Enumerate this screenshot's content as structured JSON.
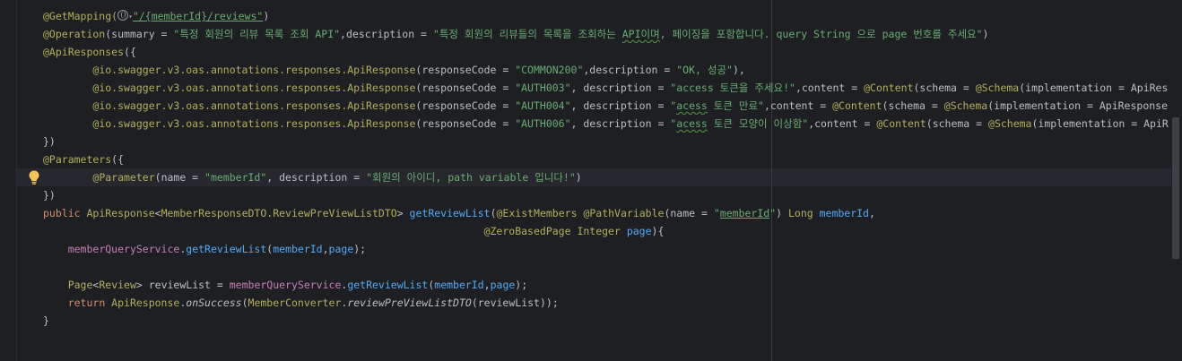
{
  "editor": {
    "lines": [
      {
        "segments": [
          {
            "t": "@GetMapping(",
            "c": "ann"
          },
          {
            "t": "icon:globe"
          },
          {
            "t": "\"/{memberId}/reviews\"",
            "c": "str u"
          },
          {
            "t": ")",
            "c": "dim"
          }
        ]
      },
      {
        "segments": [
          {
            "t": "@Operation",
            "c": "ann"
          },
          {
            "t": "(summary = ",
            "c": "dim"
          },
          {
            "t": "\"특정 회원의 리뷰 목록 조회 API\"",
            "c": "str"
          },
          {
            "t": ",description = ",
            "c": "dim"
          },
          {
            "t": "\"특정 회원의 리뷰들의 목록을 조회하는 ",
            "c": "str"
          },
          {
            "t": "API이며",
            "c": "str squig"
          },
          {
            "t": ", 페이징을 포함합니다. query String 으로 page 번호를 주세요\"",
            "c": "str"
          },
          {
            "t": ")",
            "c": "dim"
          }
        ]
      },
      {
        "segments": [
          {
            "t": "@ApiResponses",
            "c": "ann"
          },
          {
            "t": "({",
            "c": "dim"
          }
        ]
      },
      {
        "segments": [
          {
            "t": "        "
          },
          {
            "t": "@io.swagger.v3.oas.annotations.responses.ApiResponse",
            "c": "ann"
          },
          {
            "t": "(responseCode = ",
            "c": "dim"
          },
          {
            "t": "\"COMMON200\"",
            "c": "str"
          },
          {
            "t": ",description = ",
            "c": "dim"
          },
          {
            "t": "\"OK, 성공\"",
            "c": "str"
          },
          {
            "t": "),",
            "c": "dim"
          }
        ]
      },
      {
        "segments": [
          {
            "t": "        "
          },
          {
            "t": "@io.swagger.v3.oas.annotations.responses.ApiResponse",
            "c": "ann"
          },
          {
            "t": "(responseCode = ",
            "c": "dim"
          },
          {
            "t": "\"AUTH003\"",
            "c": "str"
          },
          {
            "t": ", description = ",
            "c": "dim"
          },
          {
            "t": "\"access 토큰을 주세요!\"",
            "c": "str"
          },
          {
            "t": ",content = ",
            "c": "dim"
          },
          {
            "t": "@Content",
            "c": "ann"
          },
          {
            "t": "(schema = ",
            "c": "dim"
          },
          {
            "t": "@Schema",
            "c": "ann"
          },
          {
            "t": "(implementation = ApiRes",
            "c": "dim"
          }
        ]
      },
      {
        "segments": [
          {
            "t": "        "
          },
          {
            "t": "@io.swagger.v3.oas.annotations.responses.ApiResponse",
            "c": "ann"
          },
          {
            "t": "(responseCode = ",
            "c": "dim"
          },
          {
            "t": "\"AUTH004\"",
            "c": "str"
          },
          {
            "t": ", description = ",
            "c": "dim"
          },
          {
            "t": "\"",
            "c": "str"
          },
          {
            "t": "acess",
            "c": "str squig"
          },
          {
            "t": " 토큰 만료\"",
            "c": "str"
          },
          {
            "t": ",content = ",
            "c": "dim"
          },
          {
            "t": "@Content",
            "c": "ann"
          },
          {
            "t": "(schema = ",
            "c": "dim"
          },
          {
            "t": "@Schema",
            "c": "ann"
          },
          {
            "t": "(implementation = ApiResponse",
            "c": "dim"
          }
        ]
      },
      {
        "segments": [
          {
            "t": "        "
          },
          {
            "t": "@io.swagger.v3.oas.annotations.responses.ApiResponse",
            "c": "ann"
          },
          {
            "t": "(responseCode = ",
            "c": "dim"
          },
          {
            "t": "\"AUTH006\"",
            "c": "str"
          },
          {
            "t": ", description = ",
            "c": "dim"
          },
          {
            "t": "\"",
            "c": "str"
          },
          {
            "t": "acess",
            "c": "str squig"
          },
          {
            "t": " 토큰 모양이 이상함\"",
            "c": "str"
          },
          {
            "t": ",content = ",
            "c": "dim"
          },
          {
            "t": "@Content",
            "c": "ann"
          },
          {
            "t": "(schema = ",
            "c": "dim"
          },
          {
            "t": "@Schema",
            "c": "ann"
          },
          {
            "t": "(implementation = ApiR",
            "c": "dim"
          }
        ]
      },
      {
        "segments": [
          {
            "t": "})",
            "c": "dim"
          }
        ]
      },
      {
        "segments": [
          {
            "t": "@Parameters",
            "c": "ann"
          },
          {
            "t": "({",
            "c": "dim"
          }
        ]
      },
      {
        "segments": [
          {
            "t": "        "
          },
          {
            "t": "@Parameter",
            "c": "ann"
          },
          {
            "t": "(name = ",
            "c": "dim"
          },
          {
            "t": "\"memberId\"",
            "c": "str"
          },
          {
            "t": ", description = ",
            "c": "dim"
          },
          {
            "t": "\"회원의 아이디, path variable 입니다!\"",
            "c": "str"
          },
          {
            "t": ")",
            "c": "dim"
          }
        ]
      },
      {
        "segments": [
          {
            "t": "})",
            "c": "dim"
          }
        ]
      },
      {
        "segments": [
          {
            "t": "public ",
            "c": "kw"
          },
          {
            "t": "ApiResponse",
            "c": "ann"
          },
          {
            "t": "<",
            "c": "dim"
          },
          {
            "t": "MemberResponseDTO.ReviewPreViewListDTO",
            "c": "ann"
          },
          {
            "t": "> ",
            "c": "dim"
          },
          {
            "t": "getReviewList",
            "c": "method"
          },
          {
            "t": "(",
            "c": "dim"
          },
          {
            "t": "@ExistMembers ",
            "c": "ann"
          },
          {
            "t": "@PathVariable",
            "c": "ann"
          },
          {
            "t": "(name = ",
            "c": "dim"
          },
          {
            "t": "\"",
            "c": "str"
          },
          {
            "t": "memberId",
            "c": "str u"
          },
          {
            "t": "\"",
            "c": "str"
          },
          {
            "t": ") ",
            "c": "dim"
          },
          {
            "t": "Long ",
            "c": "ann"
          },
          {
            "t": "memberId",
            "c": "method"
          },
          {
            "t": ",",
            "c": "dim"
          }
        ]
      },
      {
        "segments": [
          {
            "t": "                                                                       "
          },
          {
            "t": "@ZeroBasedPage ",
            "c": "ann"
          },
          {
            "t": "Integer ",
            "c": "ann"
          },
          {
            "t": "page",
            "c": "method"
          },
          {
            "t": "){",
            "c": "dim"
          }
        ]
      },
      {
        "segments": [
          {
            "t": "    "
          },
          {
            "t": "memberQueryService",
            "c": "field"
          },
          {
            "t": ".",
            "c": "dim"
          },
          {
            "t": "getReviewList",
            "c": "method"
          },
          {
            "t": "(",
            "c": "dim"
          },
          {
            "t": "memberId",
            "c": "method"
          },
          {
            "t": ",",
            "c": "dim"
          },
          {
            "t": "page",
            "c": "method"
          },
          {
            "t": ");",
            "c": "dim"
          }
        ]
      },
      {
        "segments": [
          {
            "t": ""
          }
        ]
      },
      {
        "segments": [
          {
            "t": "    "
          },
          {
            "t": "Page",
            "c": "ann"
          },
          {
            "t": "<",
            "c": "dim"
          },
          {
            "t": "Review",
            "c": "ann"
          },
          {
            "t": "> reviewList = ",
            "c": "dim"
          },
          {
            "t": "memberQueryService",
            "c": "field"
          },
          {
            "t": ".",
            "c": "dim"
          },
          {
            "t": "getReviewList",
            "c": "method"
          },
          {
            "t": "(",
            "c": "dim"
          },
          {
            "t": "memberId",
            "c": "method"
          },
          {
            "t": ",",
            "c": "dim"
          },
          {
            "t": "page",
            "c": "method"
          },
          {
            "t": ");",
            "c": "dim"
          }
        ]
      },
      {
        "segments": [
          {
            "t": "    "
          },
          {
            "t": "return ",
            "c": "kw"
          },
          {
            "t": "ApiResponse",
            "c": "ann"
          },
          {
            "t": ".",
            "c": "dim"
          },
          {
            "t": "onSuccess",
            "c": "dim ital"
          },
          {
            "t": "(",
            "c": "dim"
          },
          {
            "t": "MemberConverter",
            "c": "ann"
          },
          {
            "t": ".",
            "c": "dim"
          },
          {
            "t": "reviewPreViewListDTO",
            "c": "dim ital"
          },
          {
            "t": "(reviewList));",
            "c": "dim"
          }
        ]
      },
      {
        "segments": [
          {
            "t": "}",
            "c": "dim"
          }
        ]
      }
    ],
    "current_line_index": 9,
    "colors": {
      "background": "#1e1f22",
      "annotation": "#b3ae60",
      "string": "#6aab73",
      "keyword": "#cf8e6d",
      "method": "#56a8f5",
      "field": "#c77dbb",
      "text": "#bcbec4"
    },
    "icons": {
      "gutter_intention": "lightbulb-icon",
      "url_globe": "globe-icon"
    }
  }
}
